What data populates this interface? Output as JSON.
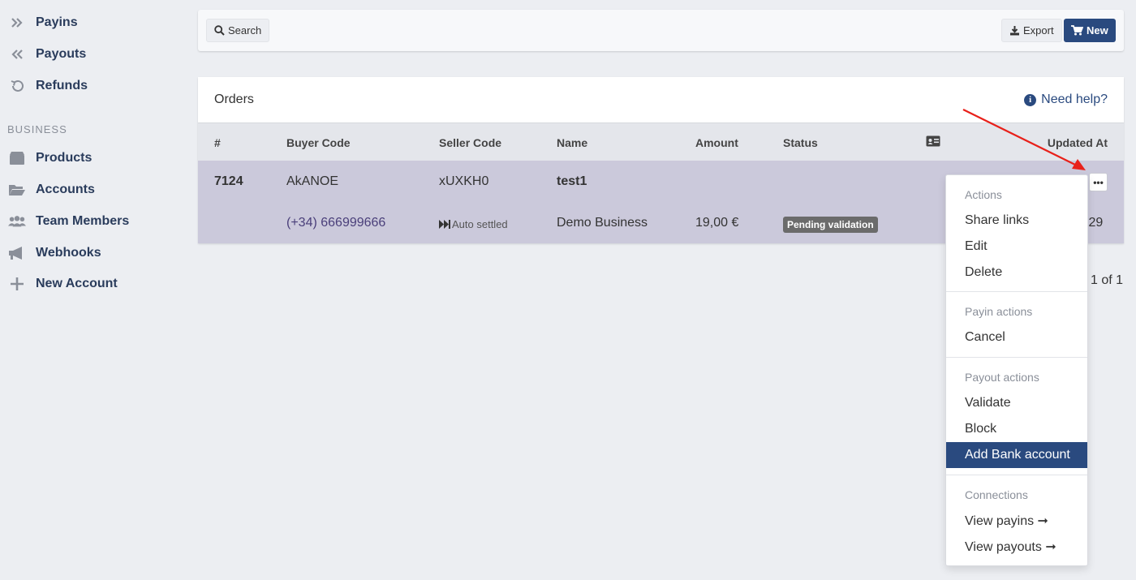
{
  "sidebar": {
    "items": [
      {
        "label": "Payins",
        "icon": "double-chevron-right-icon"
      },
      {
        "label": "Payouts",
        "icon": "double-chevron-left-icon"
      },
      {
        "label": "Refunds",
        "icon": "undo-icon"
      }
    ],
    "section_title": "BUSINESS",
    "business_items": [
      {
        "label": "Products",
        "icon": "box-icon"
      },
      {
        "label": "Accounts",
        "icon": "folder-icon"
      },
      {
        "label": "Team Members",
        "icon": "users-icon"
      },
      {
        "label": "Webhooks",
        "icon": "megaphone-icon"
      },
      {
        "label": "New Account",
        "icon": "plus-icon"
      }
    ]
  },
  "toolbar": {
    "search_label": "Search",
    "export_label": "Export",
    "new_label": "New"
  },
  "orders": {
    "title": "Orders",
    "help_label": "Need help?",
    "columns": [
      "#",
      "Buyer Code",
      "Seller Code",
      "Name",
      "Amount",
      "Status",
      "Updated At"
    ],
    "row": {
      "id": "7124",
      "buyer_code": "AkANOE",
      "seller_code": "xUXKH0",
      "name": "test1",
      "phone": "(+34) 666999666",
      "settlement": "Auto settled",
      "business": "Demo Business",
      "amount": "19,00 €",
      "status": "Pending validation",
      "updated_at_visible": ":29"
    },
    "pagination": "1 of 1"
  },
  "dropdown": {
    "sections": [
      {
        "header": "Actions",
        "items": [
          "Share links",
          "Edit",
          "Delete"
        ]
      },
      {
        "header": "Payin actions",
        "items": [
          "Cancel"
        ]
      },
      {
        "header": "Payout actions",
        "items": [
          "Validate",
          "Block",
          "Add Bank account"
        ]
      },
      {
        "header": "Connections",
        "items": [
          "View payins ➞",
          "View payouts ➞"
        ]
      }
    ],
    "active_item": "Add Bank account"
  },
  "colors": {
    "accent": "#2a4a7f",
    "row_highlight": "#cbc9db",
    "annotation_arrow": "#e8201a"
  }
}
